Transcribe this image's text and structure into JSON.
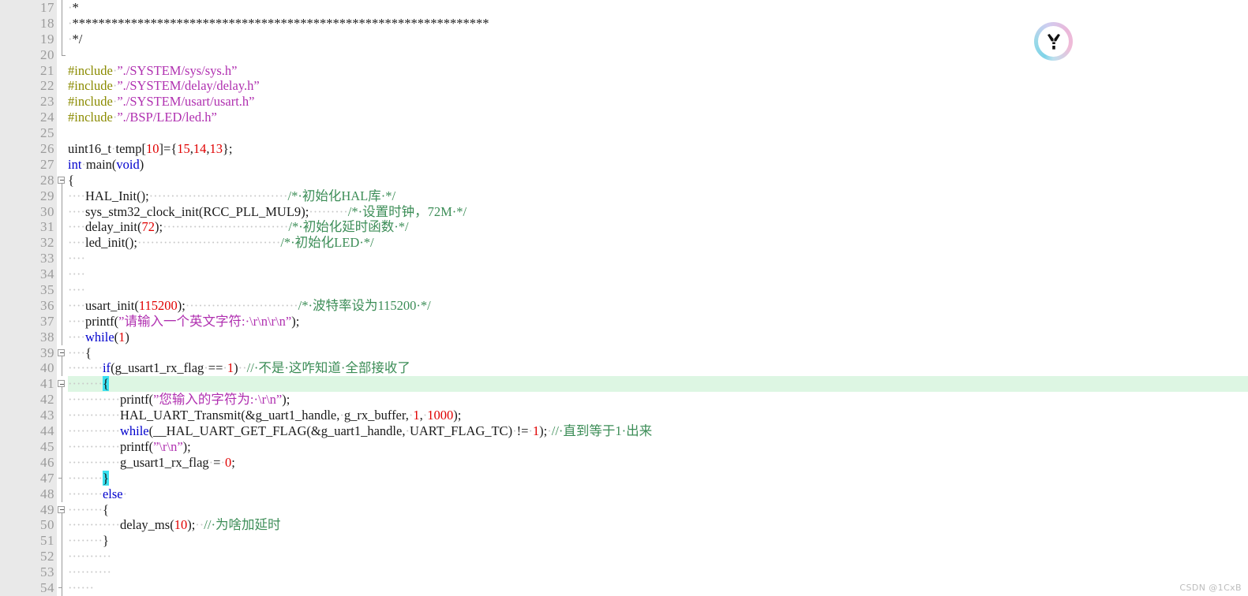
{
  "editor": {
    "gutter_color": "#e9e9e9",
    "background": "#ffffff",
    "highlight_line": 41,
    "highlight_color": "#ddf6e3",
    "bracket_match_color": "#3ae0f0",
    "first_visible_line": 17,
    "last_visible_line": 54,
    "colors": {
      "keyword": "#0000cd",
      "preprocessor": "#8b8b00",
      "string": "#b030b0",
      "number": "#e00000",
      "comment": "#3c8d57",
      "plain": "#1a1a1a",
      "whitespace_dot": "#c9c9c9"
    }
  },
  "logo": {
    "name": "tongyi-lingma-icon",
    "glyph": "Y"
  },
  "watermark": {
    "text": "CSDN @1CxB"
  },
  "lines": [
    {
      "no": "17",
      "fold": "line",
      "text": "·*"
    },
    {
      "no": "18",
      "fold": "line",
      "text": "·****************************************************************"
    },
    {
      "no": "19",
      "fold": "line",
      "text": "·*/"
    },
    {
      "no": "20",
      "fold": "end",
      "text": ""
    },
    {
      "no": "21",
      "fold": "none",
      "text": "#include·”./SYSTEM/sys/sys.h”"
    },
    {
      "no": "22",
      "fold": "none",
      "text": "#include·”./SYSTEM/delay/delay.h”"
    },
    {
      "no": "23",
      "fold": "none",
      "text": "#include·”./SYSTEM/usart/usart.h”"
    },
    {
      "no": "24",
      "fold": "none",
      "text": "#include·”./BSP/LED/led.h”"
    },
    {
      "no": "25",
      "fold": "none",
      "text": ""
    },
    {
      "no": "26",
      "fold": "none",
      "text": "uint16_t·temp[10]={15,14,13};"
    },
    {
      "no": "27",
      "fold": "none",
      "text": "int·main(void)"
    },
    {
      "no": "28",
      "fold": "box",
      "text": "{"
    },
    {
      "no": "29",
      "fold": "line",
      "text": "····HAL_Init();································/*·初始化HAL库·*/"
    },
    {
      "no": "30",
      "fold": "line",
      "text": "····sys_stm32_clock_init(RCC_PLL_MUL9);·········/*·设置时钟，72M·*/"
    },
    {
      "no": "31",
      "fold": "line",
      "text": "····delay_init(72);·····························/*·初始化延时函数·*/"
    },
    {
      "no": "32",
      "fold": "line",
      "text": "····led_init();·································/*·初始化LED·*/"
    },
    {
      "no": "33",
      "fold": "line",
      "text": "····"
    },
    {
      "no": "34",
      "fold": "line",
      "text": "····"
    },
    {
      "no": "35",
      "fold": "line",
      "text": "····"
    },
    {
      "no": "36",
      "fold": "line",
      "text": "····usart_init(115200);··························/*·波特率设为115200·*/"
    },
    {
      "no": "37",
      "fold": "line",
      "text": "····printf(”请输入一个英文字符:·\\r\\n\\r\\n”);"
    },
    {
      "no": "38",
      "fold": "line",
      "text": "····while(1)"
    },
    {
      "no": "39",
      "fold": "box",
      "text": "····{"
    },
    {
      "no": "40",
      "fold": "line",
      "text": "········if(g_usart1_rx_flag·==·1)··//·不是·这咋知道·全部接收了"
    },
    {
      "no": "41",
      "fold": "box",
      "text": "········{"
    },
    {
      "no": "42",
      "fold": "line",
      "text": "············printf(”您输入的字符为:·\\r\\n”);"
    },
    {
      "no": "43",
      "fold": "line",
      "text": "············HAL_UART_Transmit(&g_uart1_handle,·g_rx_buffer,·1,·1000);"
    },
    {
      "no": "44",
      "fold": "line",
      "text": "············while(__HAL_UART_GET_FLAG(&g_uart1_handle,·UART_FLAG_TC)·!=·1);·//·直到等于1·出来"
    },
    {
      "no": "45",
      "fold": "line",
      "text": "············printf(”\\r\\n”);"
    },
    {
      "no": "46",
      "fold": "line",
      "text": "············g_usart1_rx_flag·=·0;"
    },
    {
      "no": "47",
      "fold": "tick",
      "text": "········}"
    },
    {
      "no": "48",
      "fold": "line",
      "text": "········else·"
    },
    {
      "no": "49",
      "fold": "box",
      "text": "········{"
    },
    {
      "no": "50",
      "fold": "line",
      "text": "············delay_ms(10);··//·为啥加延时"
    },
    {
      "no": "51",
      "fold": "line",
      "text": "········}"
    },
    {
      "no": "52",
      "fold": "line",
      "text": "··········"
    },
    {
      "no": "53",
      "fold": "line",
      "text": "··········"
    },
    {
      "no": "54",
      "fold": "tick",
      "text": "······"
    }
  ]
}
